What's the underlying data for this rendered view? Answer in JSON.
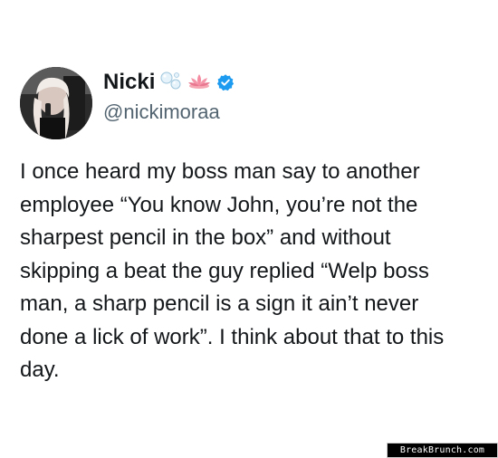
{
  "tweet": {
    "display_name": "Nicki",
    "handle": "@nickimoraa",
    "icons": [
      "bubbles-emoji",
      "lotus-emoji",
      "verified-badge-icon"
    ],
    "text_lines": [
      "I once heard my boss man say to another",
      "employee “You know John, you’re not the",
      "sharpest pencil in the box” and without",
      "skipping a beat the guy replied “Welp boss",
      "man, a sharp pencil is a sign it ain’t never",
      "done a lick of work”. I think about that to this",
      "day."
    ]
  },
  "watermark": {
    "text": "BreakBrunch.com"
  },
  "colors": {
    "text": "#14171a",
    "handle": "#536471",
    "verified": "#1d9bf0",
    "background": "#ffffff"
  }
}
